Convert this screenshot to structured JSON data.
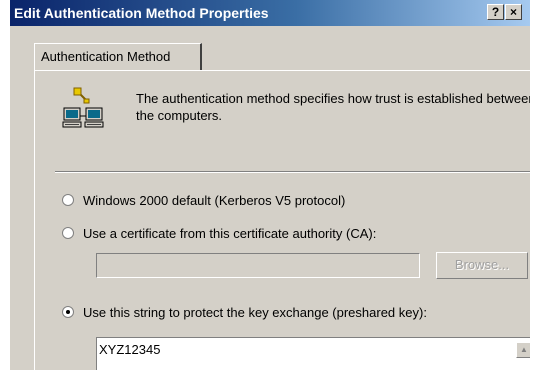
{
  "window": {
    "title": "Edit Authentication Method Properties",
    "help_label": "?",
    "close_label": "×"
  },
  "tabs": [
    {
      "label": "Authentication Method",
      "selected": true
    }
  ],
  "description": "The authentication method specifies how trust is established between the computers.",
  "options": {
    "kerberos": {
      "label": "Windows 2000 default (Kerberos V5 protocol)",
      "checked": false
    },
    "certificate": {
      "label": "Use a certificate from this certificate authority (CA):",
      "checked": false
    },
    "preshared": {
      "label": "Use this string to protect the key exchange (preshared key):",
      "checked": true
    }
  },
  "certificate_authority": {
    "value": "",
    "browse_label": "Browse..."
  },
  "preshared_key": {
    "value": "XYZ12345"
  },
  "icons": {
    "auth": "computers-key-icon",
    "scroll_up": "scroll-up-arrow-icon"
  },
  "colors": {
    "title_start": "#0a246a",
    "title_end": "#a6caf0",
    "face": "#d4d0c8"
  }
}
